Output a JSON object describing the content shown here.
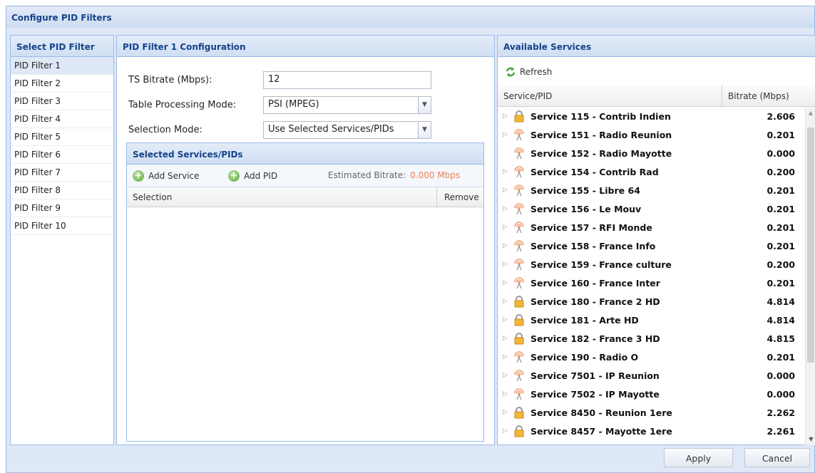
{
  "window": {
    "title": "Configure PID Filters"
  },
  "left": {
    "header": "Select PID Filter",
    "items": [
      "PID Filter 1",
      "PID Filter 2",
      "PID Filter 3",
      "PID Filter 4",
      "PID Filter 5",
      "PID Filter 6",
      "PID Filter 7",
      "PID Filter 8",
      "PID Filter 9",
      "PID Filter 10"
    ],
    "selected_index": 0
  },
  "config": {
    "header": "PID Filter 1 Configuration",
    "ts_bitrate_label": "TS Bitrate (Mbps):",
    "ts_bitrate_value": "12",
    "table_mode_label": "Table Processing Mode:",
    "table_mode_value": "PSI (MPEG)",
    "selection_mode_label": "Selection Mode:",
    "selection_mode_value": "Use Selected Services/PIDs",
    "selected": {
      "header": "Selected Services/PIDs",
      "add_service": "Add Service",
      "add_pid": "Add PID",
      "estimated_label": "Estimated Bitrate:",
      "estimated_value": "0.000 Mbps",
      "col_selection": "Selection",
      "col_remove": "Remove"
    }
  },
  "services": {
    "header": "Available Services",
    "refresh": "Refresh",
    "col_service": "Service/PID",
    "col_bitrate": "Bitrate (Mbps)",
    "rows": [
      {
        "name": "Service 115 - Contrib Indien",
        "bitrate": "2.606",
        "icon": "lock-icon",
        "expander": true
      },
      {
        "name": "Service 151 - Radio Reunion",
        "bitrate": "0.201",
        "icon": "radio-icon",
        "expander": true
      },
      {
        "name": "Service 152 - Radio Mayotte",
        "bitrate": "0.000",
        "icon": "radio-icon",
        "expander": false
      },
      {
        "name": "Service 154 - Contrib Rad",
        "bitrate": "0.200",
        "icon": "radio-icon",
        "expander": true
      },
      {
        "name": "Service 155 - Libre 64",
        "bitrate": "0.201",
        "icon": "radio-icon",
        "expander": true
      },
      {
        "name": "Service 156 - Le Mouv",
        "bitrate": "0.201",
        "icon": "radio-icon",
        "expander": true
      },
      {
        "name": "Service 157 - RFI Monde",
        "bitrate": "0.201",
        "icon": "radio-icon",
        "expander": true
      },
      {
        "name": "Service 158 - France Info",
        "bitrate": "0.201",
        "icon": "radio-icon",
        "expander": true
      },
      {
        "name": "Service 159 - France culture",
        "bitrate": "0.200",
        "icon": "radio-icon",
        "expander": true
      },
      {
        "name": "Service 160 - France Inter",
        "bitrate": "0.201",
        "icon": "radio-icon",
        "expander": true
      },
      {
        "name": "Service 180 - France 2 HD",
        "bitrate": "4.814",
        "icon": "lock-icon",
        "expander": true
      },
      {
        "name": "Service 181 - Arte HD",
        "bitrate": "4.814",
        "icon": "lock-icon",
        "expander": true
      },
      {
        "name": "Service 182 - France 3 HD",
        "bitrate": "4.815",
        "icon": "lock-icon",
        "expander": true
      },
      {
        "name": "Service 190 - Radio O",
        "bitrate": "0.201",
        "icon": "radio-icon",
        "expander": true
      },
      {
        "name": "Service 7501 - IP Reunion",
        "bitrate": "0.000",
        "icon": "radio-icon",
        "expander": true
      },
      {
        "name": "Service 7502 - IP Mayotte",
        "bitrate": "0.000",
        "icon": "radio-icon",
        "expander": true
      },
      {
        "name": "Service 8450 - Reunion 1ere",
        "bitrate": "2.262",
        "icon": "lock-icon",
        "expander": true
      },
      {
        "name": "Service 8457 - Mayotte 1ere",
        "bitrate": "2.261",
        "icon": "lock-icon",
        "expander": true
      }
    ]
  },
  "footer": {
    "apply": "Apply",
    "cancel": "Cancel"
  },
  "colors": {
    "header_text": "#15428b",
    "estimated_bitrate": "#f07f52",
    "border": "#99bbe8"
  }
}
